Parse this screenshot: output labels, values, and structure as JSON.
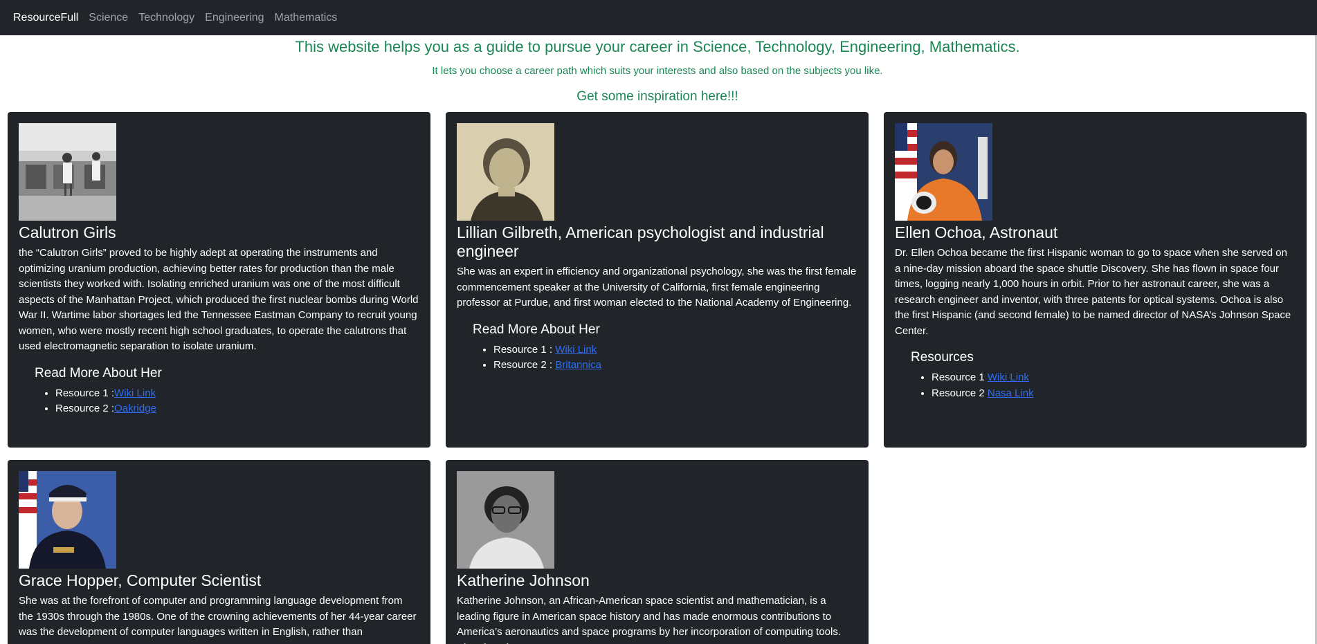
{
  "nav": {
    "brand": "ResourceFull",
    "links": [
      "Science",
      "Technology",
      "Engineering",
      "Mathematics"
    ]
  },
  "hero": {
    "title": "This website helps you as a guide to pursue your career in Science, Technology, Engineering, Mathematics.",
    "subtitle": "It lets you choose a career path which suits your interests and also based on the subjects you like.",
    "inspiration": "Get some inspiration here!!!"
  },
  "colors": {
    "navbar_bg": "#212529",
    "card_bg": "#212529",
    "accent_green": "#198754",
    "link_blue": "#2f6df6"
  },
  "cards": [
    {
      "image_icon": "calutron-girls-photo",
      "title": "Calutron Girls",
      "text": "the “Calutron Girls” proved to be highly adept at operating the instruments and optimizing uranium production, achieving better rates for production than the male scientists they worked with. Isolating enriched uranium was one of the most difficult aspects of the Manhattan Project, which produced the first nuclear bombs during World War II. Wartime labor shortages led the Tennessee Eastman Company to recruit young women, who were mostly recent high school graduates, to operate the calutrons that used electromagnetic separation to isolate uranium.",
      "resources_heading": "Read More About Her",
      "resources": [
        {
          "prefix": "Resource 1 :",
          "link": "Wiki Link"
        },
        {
          "prefix": "Resource 2 :",
          "link": "Oakridge"
        }
      ]
    },
    {
      "image_icon": "lillian-gilbreth-photo",
      "title": "Lillian Gilbreth, American psychologist and industrial engineer",
      "text": "She was an expert in efficiency and organizational psychology, she was the first female commencement speaker at the University of California, first female engineering professor at Purdue, and first woman elected to the National Academy of Engineering.",
      "resources_heading": "Read More About Her",
      "resources": [
        {
          "prefix": "Resource 1 : ",
          "link": "Wiki Link"
        },
        {
          "prefix": "Resource 2 : ",
          "link": "Britannica"
        }
      ]
    },
    {
      "image_icon": "ellen-ochoa-photo",
      "title": "Ellen Ochoa, Astronaut",
      "text": "Dr. Ellen Ochoa became the first Hispanic woman to go to space when she served on a nine-day mission aboard the space shuttle Discovery. She has flown in space four times, logging nearly 1,000 hours in orbit. Prior to her astronaut career, she was a research engineer and inventor, with three patents for optical systems. Ochoa is also the first Hispanic (and second female) to be named director of NASA’s Johnson Space Center.",
      "resources_heading": "Resources",
      "resources": [
        {
          "prefix": "Resource 1 ",
          "link": "Wiki Link"
        },
        {
          "prefix": "Resource 2 ",
          "link": "Nasa Link"
        }
      ]
    },
    {
      "image_icon": "grace-hopper-photo",
      "title": "Grace Hopper, Computer Scientist",
      "text": "She was at the forefront of computer and programming language development from the 1930s through the 1980s. One of the crowning achievements of her 44-year career was the development of computer languages written in English, rather than"
    },
    {
      "image_icon": "katherine-johnson-photo",
      "title": "Katherine Johnson",
      "text": "Katherine Johnson, an African-American space scientist and mathematician, is a leading figure in American space history and has made enormous contributions to America’s aeronautics and space programs by her incorporation of computing tools. She played a"
    }
  ]
}
